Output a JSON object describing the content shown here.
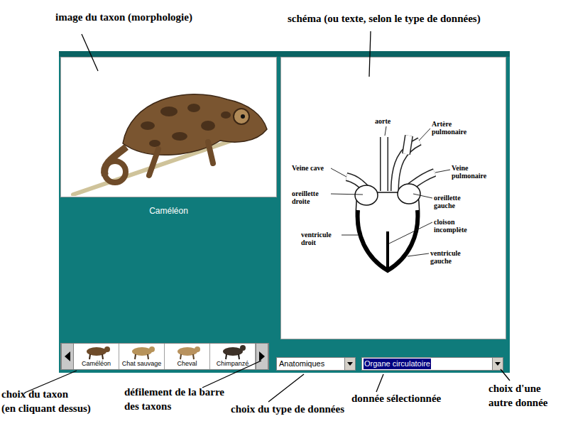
{
  "annotations": [
    {
      "lines": [
        "image du taxon (morphologie)"
      ]
    },
    {
      "lines": [
        "schéma (ou texte, selon le type de données)"
      ]
    },
    {
      "lines": [
        "choix du taxon",
        "(en cliquant dessus)"
      ]
    },
    {
      "lines": [
        "défilement de la barre",
        "des taxons"
      ]
    },
    {
      "lines": [
        "choix du type de données"
      ]
    },
    {
      "lines": [
        "donnée sélectionnée"
      ]
    },
    {
      "lines": [
        "choix d'une",
        "autre donnée"
      ]
    }
  ],
  "viewer": {
    "taxon_name": "Caméléon"
  },
  "diagram": {
    "labels": [
      {
        "lines": [
          "aorte"
        ]
      },
      {
        "lines": [
          "Artère",
          "pulmonaire"
        ]
      },
      {
        "lines": [
          "Veine cave"
        ]
      },
      {
        "lines": [
          "Veine",
          "pulmonaire"
        ]
      },
      {
        "lines": [
          "oreillette",
          "droite"
        ]
      },
      {
        "lines": [
          "oreillette",
          "gauche"
        ]
      },
      {
        "lines": [
          "cloison",
          "incomplète"
        ]
      },
      {
        "lines": [
          "ventricule",
          "droit"
        ]
      },
      {
        "lines": [
          "ventricule",
          "gauche"
        ]
      }
    ]
  },
  "taxa_bar": {
    "items": [
      {
        "label": "Caméléon"
      },
      {
        "label": "Chat sauvage"
      },
      {
        "label": "Cheval"
      },
      {
        "label": "Chimpanzé"
      }
    ]
  },
  "data_type": {
    "value": "Anatomiques"
  },
  "data_item": {
    "value": "Organe circulatoire",
    "highlighted": true
  }
}
